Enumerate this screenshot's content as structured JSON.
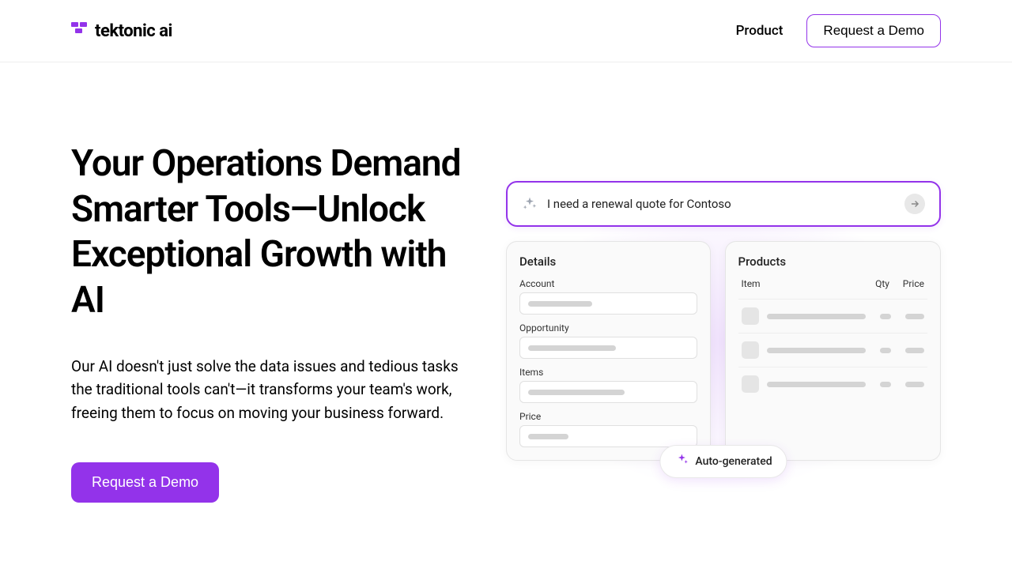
{
  "brand": {
    "name": "tektonic ai"
  },
  "nav": {
    "product": "Product",
    "demo": "Request a Demo"
  },
  "hero": {
    "headline": "Your Operations Demand Smarter Tools—Unlock Exceptional Growth with AI",
    "subtext": "Our AI doesn't just solve the data issues and tedious tasks the traditional tools can't—it transforms your team's work, freeing them to focus on moving your business forward.",
    "cta": "Request a Demo"
  },
  "illustration": {
    "prompt": "I need a renewal quote for Contoso",
    "details": {
      "title": "Details",
      "fields": {
        "account": "Account",
        "opportunity": "Opportunity",
        "items": "Items",
        "price": "Price"
      }
    },
    "products": {
      "title": "Products",
      "columns": {
        "item": "Item",
        "qty": "Qty",
        "price": "Price"
      }
    },
    "chip": "Auto-generated"
  },
  "colors": {
    "accent": "#9333ea",
    "accent_light": "#c084fc"
  }
}
